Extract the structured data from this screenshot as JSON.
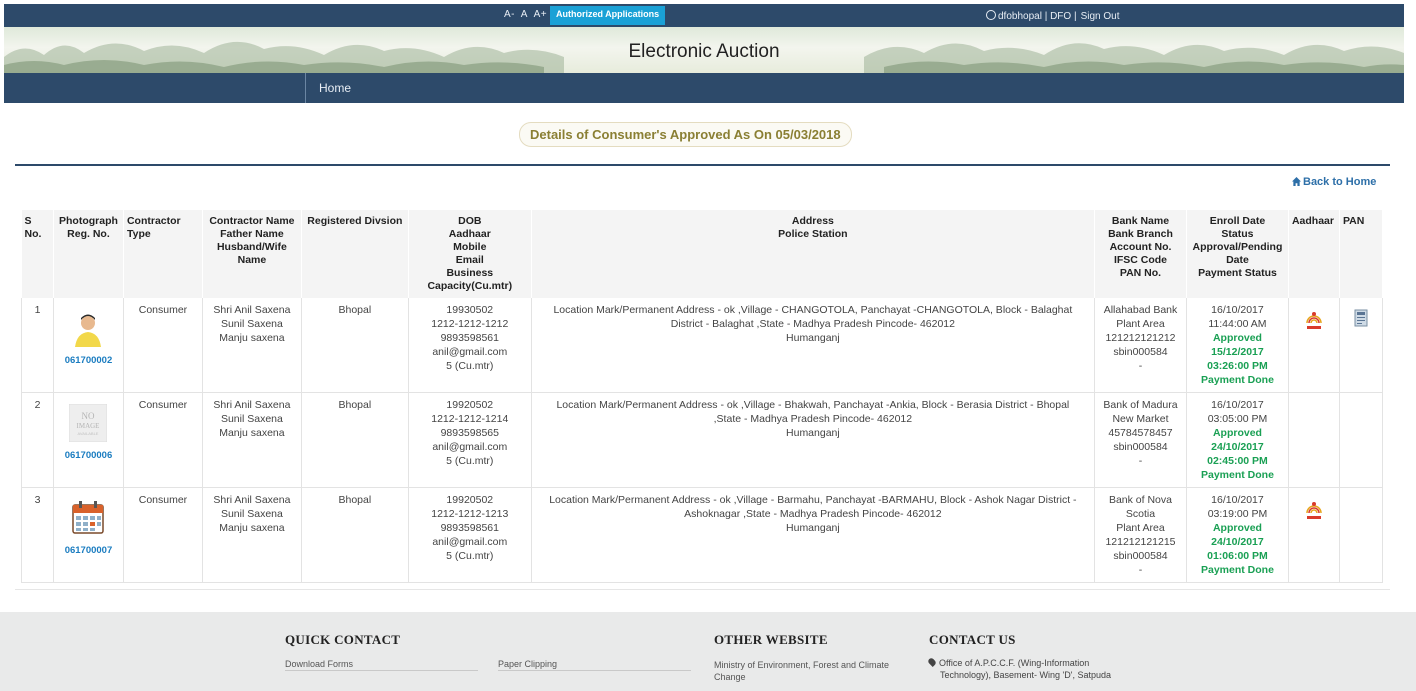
{
  "topbar": {
    "font_small": "A-",
    "font_normal": "A",
    "font_large": "A+",
    "authorized_label": "Authorized Applications",
    "user_text": "dfobhopal | DFO |",
    "signout_label": "Sign Out"
  },
  "banner": {
    "title": "Electronic Auction"
  },
  "menu": {
    "home_label": "Home"
  },
  "page": {
    "heading": "Details of Consumer's Approved As On 05/03/2018",
    "back_home_label": "Back to Home"
  },
  "table": {
    "headers": {
      "sno": [
        "S",
        "No."
      ],
      "photo": [
        "Photograph",
        "Reg. No."
      ],
      "type": [
        "Contractor",
        "Type"
      ],
      "name": [
        "Contractor Name",
        "Father Name",
        "Husband/Wife",
        "Name"
      ],
      "division": [
        "Registered Divsion"
      ],
      "dob": [
        "DOB",
        "Aadhaar",
        "Mobile",
        "Email",
        "Business",
        "Capacity(Cu.mtr)"
      ],
      "address": [
        "Address",
        "Police Station"
      ],
      "bank": [
        "Bank Name",
        "Bank Branch",
        "Account No.",
        "IFSC Code",
        "PAN No."
      ],
      "enroll": [
        "Enroll Date",
        "Status",
        "Approval/Pending",
        "Date",
        "Payment Status"
      ],
      "aadhaar": "Aadhaar",
      "pan": "PAN"
    },
    "rows": [
      {
        "sno": "1",
        "photo_icon": "person-photo",
        "reg_no": "061700002",
        "type": "Consumer",
        "name": [
          "Shri Anil Saxena",
          "Sunil Saxena",
          "Manju saxena"
        ],
        "division": "Bhopal",
        "dob": [
          "19930502",
          "1212-1212-1212",
          "9893598561",
          "anil@gmail.com",
          "5 (Cu.mtr)"
        ],
        "address": [
          "Location Mark/Permanent Address - ok ,Village - CHANGOTOLA, Panchayat -CHANGOTOLA, Block - Balaghat",
          "District - Balaghat ,State - Madhya Pradesh Pincode- 462012",
          "Humanganj"
        ],
        "bank": [
          "Allahabad Bank",
          "Plant Area",
          "121212121212",
          "sbin000584",
          "-"
        ],
        "enroll_date": "16/10/2017 11:44:00 AM",
        "status": "Approved",
        "approval_date": "15/12/2017 03:26:00 PM",
        "payment": "Payment Done",
        "has_aadhaar": true,
        "has_pan": true
      },
      {
        "sno": "2",
        "photo_icon": "no-image-placeholder",
        "reg_no": "061700006",
        "type": "Consumer",
        "name": [
          "Shri Anil Saxena",
          "Sunil Saxena",
          "Manju saxena"
        ],
        "division": "Bhopal",
        "dob": [
          "19920502",
          "1212-1212-1214",
          "9893598565",
          "anil@gmail.com",
          "5 (Cu.mtr)"
        ],
        "address": [
          "Location Mark/Permanent Address - ok ,Village - Bhakwah, Panchayat -Ankia, Block - Berasia District - Bhopal",
          ",State - Madhya Pradesh Pincode- 462012",
          "Humanganj"
        ],
        "bank": [
          "Bank of Madura",
          "New Market",
          "45784578457",
          "sbin000584",
          "-"
        ],
        "enroll_date": "16/10/2017 03:05:00 PM",
        "status": "Approved",
        "approval_date": "24/10/2017 02:45:00 PM",
        "payment": "Payment Done",
        "has_aadhaar": false,
        "has_pan": false
      },
      {
        "sno": "3",
        "photo_icon": "calendar-photo",
        "reg_no": "061700007",
        "type": "Consumer",
        "name": [
          "Shri Anil Saxena",
          "Sunil Saxena",
          "Manju saxena"
        ],
        "division": "Bhopal",
        "dob": [
          "19920502",
          "1212-1212-1213",
          "9893598561",
          "anil@gmail.com",
          "5 (Cu.mtr)"
        ],
        "address": [
          "Location Mark/Permanent Address - ok ,Village - Barmahu, Panchayat -BARMAHU, Block - Ashok Nagar District -",
          "Ashoknagar ,State - Madhya Pradesh Pincode- 462012",
          "Humanganj"
        ],
        "bank": [
          "Bank of Nova",
          "Scotia",
          "Plant Area",
          "121212121215",
          "sbin000584",
          "-"
        ],
        "enroll_date": "16/10/2017 03:19:00 PM",
        "status": "Approved",
        "approval_date": "24/10/2017 01:06:00 PM",
        "payment": "Payment Done",
        "has_aadhaar": true,
        "has_pan": false
      }
    ]
  },
  "footer": {
    "quick_contact_title": "QUICK CONTACT",
    "download_forms": "Download Forms",
    "paper_clipping": "Paper Clipping",
    "other_website_title": "OTHER WEBSITE",
    "moef_link": [
      "Ministry of Environment, Forest and Climate",
      "Change"
    ],
    "contact_us_title": "CONTACT US",
    "contact_address": [
      "Office of A.P.C.C.F. (Wing-Information",
      "Technology), Basement- Wing 'D', Satpuda"
    ]
  },
  "colors": {
    "nav_bg": "#2d4a6a",
    "auth_btn": "#1aa1d6",
    "heading_text": "#8a7f33",
    "link_blue": "#1a7cc0",
    "approved_green": "#1aa054"
  }
}
